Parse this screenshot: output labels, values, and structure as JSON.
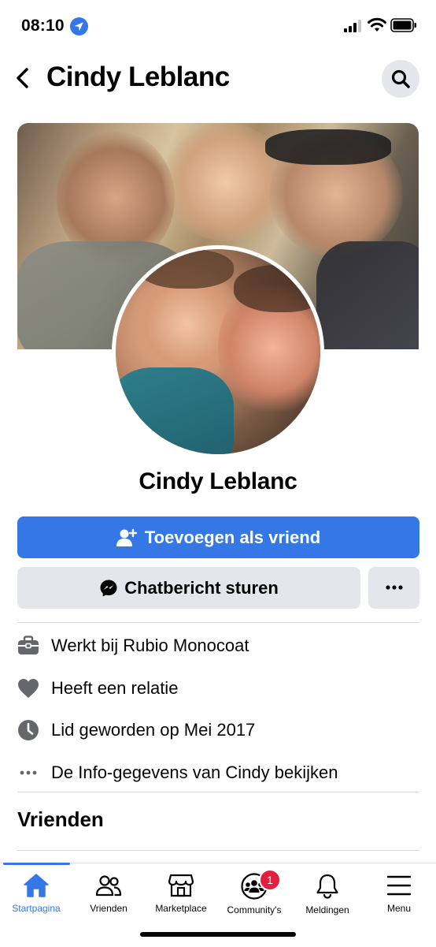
{
  "status_bar": {
    "time": "08:10"
  },
  "header": {
    "title": "Cindy Leblanc"
  },
  "profile": {
    "name": "Cindy Leblanc"
  },
  "actions": {
    "add_friend_label": "Toevoegen als vriend",
    "message_label": "Chatbericht sturen"
  },
  "info": {
    "work_prefix": "Werkt bij ",
    "work_company": "Rubio Monocoat",
    "relationship": "Heeft een relatie",
    "joined": "Lid geworden op Mei 2017",
    "about_link": "De Info-gegevens van Cindy bekijken"
  },
  "sections": {
    "friends_title": "Vrienden"
  },
  "tabbar": {
    "active": "home",
    "items": [
      {
        "label": "Startpagina",
        "icon": "home-icon"
      },
      {
        "label": "Vrienden",
        "icon": "friends-icon"
      },
      {
        "label": "Marketplace",
        "icon": "marketplace-icon"
      },
      {
        "label": "Community's",
        "icon": "groups-icon",
        "badge": "1"
      },
      {
        "label": "Meldingen",
        "icon": "bell-icon"
      },
      {
        "label": "Menu",
        "icon": "menu-icon"
      }
    ]
  },
  "colors": {
    "accent": "#3578e5",
    "secondary_button": "#e4e6eb",
    "badge": "#e41e3f"
  }
}
